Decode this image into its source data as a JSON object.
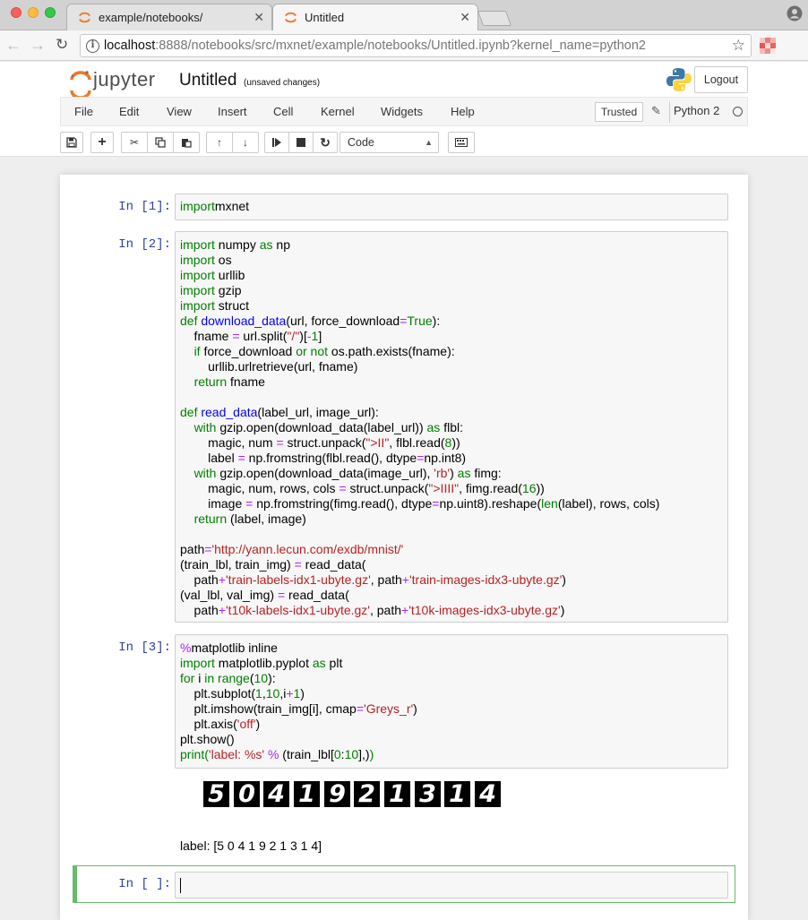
{
  "browser": {
    "tabs": [
      {
        "label": "example/notebooks/",
        "active": false
      },
      {
        "label": "Untitled",
        "active": true
      }
    ],
    "url_host": "localhost",
    "url_rest": ":8888/notebooks/src/mxnet/example/notebooks/Untitled.ipynb?kernel_name=python2"
  },
  "header": {
    "logo_text": "jupyter",
    "notebook_title": "Untitled",
    "save_status": "(unsaved changes)",
    "logout_label": "Logout"
  },
  "menubar": {
    "items": [
      "File",
      "Edit",
      "View",
      "Insert",
      "Cell",
      "Kernel",
      "Widgets",
      "Help"
    ],
    "trusted": "Trusted",
    "kernel_name": "Python 2"
  },
  "toolbar": {
    "cell_type": "Code"
  },
  "cells": [
    {
      "prompt": "In [1]:",
      "lines": [
        [
          [
            "kw",
            "import"
          ],
          [
            "",
            "mxnet"
          ]
        ]
      ]
    },
    {
      "prompt": "In [2]:",
      "lines": [
        [
          [
            "kw",
            "import"
          ],
          [
            "",
            " numpy "
          ],
          [
            "kw",
            "as"
          ],
          [
            "",
            " np"
          ]
        ],
        [
          [
            "kw",
            "import"
          ],
          [
            "",
            " os"
          ]
        ],
        [
          [
            "kw",
            "import"
          ],
          [
            "",
            " urllib"
          ]
        ],
        [
          [
            "kw",
            "import"
          ],
          [
            "",
            " gzip"
          ]
        ],
        [
          [
            "kw",
            "import"
          ],
          [
            "",
            " struct"
          ]
        ],
        [
          [
            "kw",
            "def"
          ],
          [
            "",
            " "
          ],
          [
            "fn",
            "download_data"
          ],
          [
            "",
            "(url, force_download"
          ],
          [
            "op",
            "="
          ],
          [
            "kw",
            "True"
          ],
          [
            "",
            "):"
          ]
        ],
        [
          [
            "",
            "    fname "
          ],
          [
            "op",
            "="
          ],
          [
            "",
            " url.split("
          ],
          [
            "st",
            "\"/\""
          ],
          [
            "",
            ")["
          ],
          [
            "op",
            "-"
          ],
          [
            "nm",
            "1"
          ],
          [
            "",
            "]"
          ]
        ],
        [
          [
            "",
            "    "
          ],
          [
            "kw",
            "if"
          ],
          [
            "",
            " force_download "
          ],
          [
            "kw",
            "or"
          ],
          [
            "",
            " "
          ],
          [
            "kw",
            "not"
          ],
          [
            "",
            " os.path.exists(fname):"
          ]
        ],
        [
          [
            "",
            "        urllib.urlretrieve(url, fname)"
          ]
        ],
        [
          [
            "",
            "    "
          ],
          [
            "kw",
            "return"
          ],
          [
            "",
            " fname"
          ]
        ],
        [
          [
            "",
            ""
          ]
        ],
        [
          [
            "kw",
            "def"
          ],
          [
            "",
            " "
          ],
          [
            "fn",
            "read_data"
          ],
          [
            "",
            "(label_url, image_url):"
          ]
        ],
        [
          [
            "",
            "    "
          ],
          [
            "kw",
            "with"
          ],
          [
            "",
            " gzip.open(download_data(label_url)) "
          ],
          [
            "kw",
            "as"
          ],
          [
            "",
            " flbl:"
          ]
        ],
        [
          [
            "",
            "        magic, num "
          ],
          [
            "op",
            "="
          ],
          [
            "",
            " struct.unpack("
          ],
          [
            "st",
            "\">II\""
          ],
          [
            "",
            ", flbl.read("
          ],
          [
            "nm",
            "8"
          ],
          [
            "",
            "))"
          ]
        ],
        [
          [
            "",
            "        label "
          ],
          [
            "op",
            "="
          ],
          [
            "",
            " np.fromstring(flbl.read(), dtype"
          ],
          [
            "op",
            "="
          ],
          [
            "",
            "np.int8)"
          ]
        ],
        [
          [
            "",
            "    "
          ],
          [
            "kw",
            "with"
          ],
          [
            "",
            " gzip.open(download_data(image_url), "
          ],
          [
            "st",
            "'rb'"
          ],
          [
            "",
            ") "
          ],
          [
            "kw",
            "as"
          ],
          [
            "",
            " fimg:"
          ]
        ],
        [
          [
            "",
            "        magic, num, rows, cols "
          ],
          [
            "op",
            "="
          ],
          [
            "",
            " struct.unpack("
          ],
          [
            "st",
            "\">IIII\""
          ],
          [
            "",
            ", fimg.read("
          ],
          [
            "nm",
            "16"
          ],
          [
            "",
            "))"
          ]
        ],
        [
          [
            "",
            "        image "
          ],
          [
            "op",
            "="
          ],
          [
            "",
            " np.fromstring(fimg.read(), dtype"
          ],
          [
            "op",
            "="
          ],
          [
            "",
            "np.uint8).reshape("
          ],
          [
            "kw",
            "len"
          ],
          [
            "",
            "(label), rows, cols)"
          ]
        ],
        [
          [
            "",
            "    "
          ],
          [
            "kw",
            "return"
          ],
          [
            "",
            " (label, image)"
          ]
        ],
        [
          [
            "",
            ""
          ]
        ],
        [
          [
            "",
            "path"
          ],
          [
            "op",
            "="
          ],
          [
            "st",
            "'http://yann.lecun.com/exdb/mnist/'"
          ]
        ],
        [
          [
            "",
            "(train_lbl, train_img) "
          ],
          [
            "op",
            "="
          ],
          [
            "",
            " read_data("
          ]
        ],
        [
          [
            "",
            "    path"
          ],
          [
            "op",
            "+"
          ],
          [
            "st",
            "'train-labels-idx1-ubyte.gz'"
          ],
          [
            "",
            ", path"
          ],
          [
            "op",
            "+"
          ],
          [
            "st",
            "'train-images-idx3-ubyte.gz'"
          ],
          [
            "",
            ")"
          ]
        ],
        [
          [
            "",
            "(val_lbl, val_img) "
          ],
          [
            "op",
            "="
          ],
          [
            "",
            " read_data("
          ]
        ],
        [
          [
            "",
            "    path"
          ],
          [
            "op",
            "+"
          ],
          [
            "st",
            "'t10k-labels-idx1-ubyte.gz'"
          ],
          [
            "",
            ", path"
          ],
          [
            "op",
            "+"
          ],
          [
            "st",
            "'t10k-images-idx3-ubyte.gz'"
          ],
          [
            "",
            ")"
          ]
        ]
      ]
    },
    {
      "prompt": "In [3]:",
      "lines": [
        [
          [
            "op",
            "%"
          ],
          [
            "",
            "matplotlib inline"
          ]
        ],
        [
          [
            "kw",
            "import"
          ],
          [
            "",
            " matplotlib.pyplot "
          ],
          [
            "kw",
            "as"
          ],
          [
            "",
            " plt"
          ]
        ],
        [
          [
            "kw",
            "for"
          ],
          [
            "",
            " i "
          ],
          [
            "kw",
            "in"
          ],
          [
            "",
            " "
          ],
          [
            "kw",
            "range"
          ],
          [
            "",
            "("
          ],
          [
            "nm",
            "10"
          ],
          [
            "",
            "):"
          ]
        ],
        [
          [
            "",
            "    plt.subplot("
          ],
          [
            "nm",
            "1"
          ],
          [
            "",
            ","
          ],
          [
            "nm",
            "10"
          ],
          [
            "",
            ",i"
          ],
          [
            "op",
            "+"
          ],
          [
            "nm",
            "1"
          ],
          [
            "",
            ")"
          ]
        ],
        [
          [
            "",
            "    plt.imshow(train_img[i], cmap"
          ],
          [
            "op",
            "="
          ],
          [
            "st",
            "'Greys_r'"
          ],
          [
            "",
            ")"
          ]
        ],
        [
          [
            "",
            "    plt.axis("
          ],
          [
            "st",
            "'off'"
          ],
          [
            "",
            ")"
          ]
        ],
        [
          [
            "",
            "plt.show()"
          ]
        ],
        [
          [
            "kw",
            "print"
          ],
          [
            "kw",
            "("
          ],
          [
            "st",
            "'label: %s'"
          ],
          [
            "",
            " "
          ],
          [
            "op",
            "%"
          ],
          [
            "",
            " (train_lbl["
          ],
          [
            "nm",
            "0"
          ],
          [
            "",
            ":"
          ],
          [
            "nm",
            "10"
          ],
          [
            "",
            "],)"
          ],
          [
            "kw",
            ")"
          ]
        ]
      ]
    }
  ],
  "output": {
    "digits": [
      "5",
      "0",
      "4",
      "1",
      "9",
      "2",
      "1",
      "3",
      "1",
      "4"
    ],
    "label_text": "label: [5 0 4 1 9 2 1 3 1 4]"
  },
  "empty_cell": {
    "prompt": "In [ ]:"
  }
}
